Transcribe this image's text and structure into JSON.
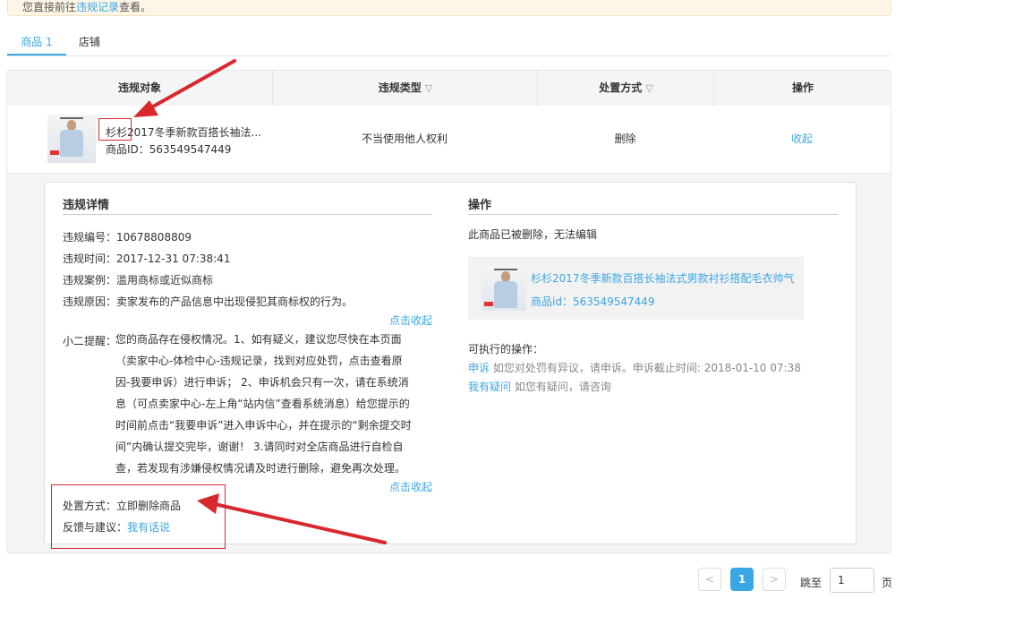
{
  "notice": {
    "prefix": "您直接前往",
    "link": "违规记录",
    "suffix": "查看。"
  },
  "tabs": [
    {
      "label": "商品 1"
    },
    {
      "label": "店铺"
    }
  ],
  "table": {
    "headers": [
      "违规对象",
      "违规类型",
      "处置方式",
      "操作"
    ],
    "row": {
      "product_name": "杉杉2017冬季新款百搭长袖法...",
      "product_id": "商品ID：563549547449",
      "violation_type": "不当使用他人权利",
      "disposal": "删除",
      "action": "收起"
    }
  },
  "detail": {
    "left_title": "违规详情",
    "violation_no": "违规编号：10678808809",
    "violation_time": "违规时间：2017-12-31 07:38:41",
    "violation_case": "违规案例：滥用商标或近似商标",
    "violation_reason": "违规原因：卖家发布的产品信息中出现侵犯其商标权的行为。",
    "collapse1": "点击收起",
    "tip_label": "小二提醒：",
    "tip_text": "您的商品存在侵权情况。1、如有疑义，建议您尽快在本页面（卖家中心-体检中心-违规记录，找到对应处罚，点击查看原因-我要申诉）进行申诉；  2、申诉机会只有一次，请在系统消息（可点卖家中心-左上角“站内信”查看系统消息）给您提示的时间前点击“我要申诉”进入申诉中心，并在提示的“剩余提交时间”内确认提交完毕，谢谢！ 3.请同时对全店商品进行自检自查，若发现有涉嫌侵权情况请及时进行删除，避免再次处理。",
    "collapse2": "点击收起",
    "disposal_label": "处置方式：",
    "disposal_value": "立即删除商品",
    "feedback_label": "反馈与建议：",
    "feedback_link": "我有话说",
    "right_title": "操作",
    "deleted_note": "此商品已被删除，无法编辑",
    "card_name": "杉杉2017冬季新款百搭长袖法式男款衬衫搭配毛衣帅气",
    "card_id": "商品id：563549547449",
    "actions_label": "可执行的操作：",
    "appeal_link": "申诉",
    "appeal_desc": "如您对处罚有异议，请申诉。申诉截止时间: 2018-01-10 07:38",
    "question_link": "我有疑问",
    "question_desc": "如您有疑问，请咨询"
  },
  "pagination": {
    "prev": "<",
    "current": "1",
    "next": ">",
    "jump_label": "跳至",
    "input_value": "1",
    "page_label": "页"
  },
  "colors": {
    "accent": "#3ba6e4",
    "annotation": "#d9272e"
  }
}
